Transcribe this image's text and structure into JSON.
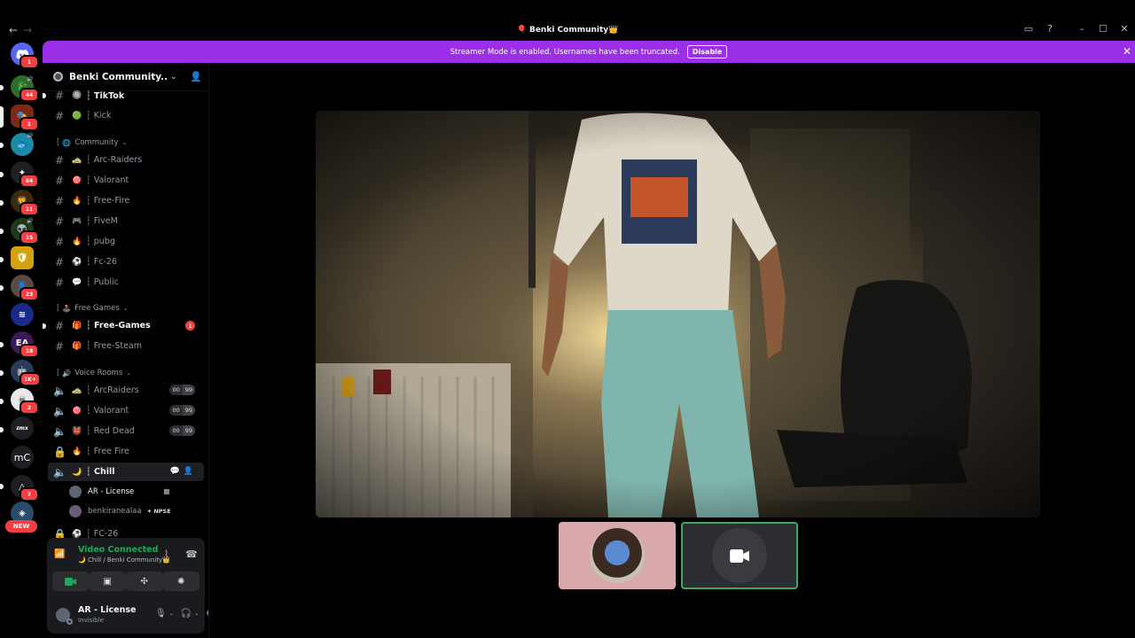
{
  "window": {
    "title": "Benki Community",
    "title_prefix_emoji": "🎈",
    "title_suffix_emoji": "👑",
    "back_icon": "arrow-left-icon",
    "forward_icon": "arrow-right-icon"
  },
  "rail": {
    "home_badge": "1",
    "badges": [
      "44",
      "1",
      "64",
      "11",
      "15",
      "23",
      "18",
      "1K+",
      "2",
      "7"
    ],
    "text_items": [
      "EA",
      "mC"
    ],
    "new_label": "NEW"
  },
  "banner": {
    "message": "Streamer Mode is enabled. Usernames have been truncated.",
    "button_label": "Disable",
    "color": "#9b2fe8"
  },
  "server": {
    "name": "Benki Community...",
    "invite_icon": "add-user-icon"
  },
  "channels": {
    "top": [
      {
        "emoji": "🔘",
        "label": "┆ TikTok",
        "unread": true
      },
      {
        "emoji": "🟢",
        "label": "┆ Kick",
        "unread": false
      }
    ],
    "community_category": {
      "emoji": "🌐",
      "label": "Community"
    },
    "community": [
      {
        "emoji": "🚕",
        "label": "┆ Arc-Raiders"
      },
      {
        "emoji": "🎯",
        "label": "┆ Valorant"
      },
      {
        "emoji": "🔥",
        "label": "┆ Free-Fire"
      },
      {
        "emoji": "🎮",
        "label": "┆ FiveM"
      },
      {
        "emoji": "🔥",
        "label": "┆ pubg"
      },
      {
        "emoji": "⚽",
        "label": "┆ Fc-26"
      },
      {
        "emoji": "💬",
        "label": "┆ Public"
      }
    ],
    "free_category": {
      "emoji": "🕹️",
      "label": "Free Games"
    },
    "free": [
      {
        "emoji": "🎁",
        "label": "┆ Free-Games",
        "mentions": "1"
      },
      {
        "emoji": "🎁",
        "label": "┆ Free-Steam"
      }
    ],
    "voice_category": {
      "emoji": "🔊",
      "label": "Voice Rooms"
    },
    "voice": [
      {
        "emoji": "🚕",
        "label": "┆ ArcRaiders",
        "count": "00",
        "limit": "99"
      },
      {
        "emoji": "🎯",
        "label": "┆ Valorant",
        "count": "00",
        "limit": "99"
      },
      {
        "emoji": "👹",
        "label": "┆ Red Dead",
        "count": "00",
        "limit": "99"
      },
      {
        "emoji": "🔥",
        "label": "┆ Free Fire"
      },
      {
        "emoji": "🌙",
        "label": "┆ Chill"
      },
      {
        "emoji": "⚽",
        "label": "┆ FC-26"
      }
    ],
    "chill_users": [
      {
        "name": "AR - License",
        "camera": true
      },
      {
        "name": "benkiranealaa",
        "tag": "NPSE"
      }
    ]
  },
  "voice_panel": {
    "status": "Video Connected",
    "location": "Chill / Benki Community",
    "location_emoji": "🌙",
    "buttons": [
      "camera-icon",
      "screen-share-icon",
      "activities-icon",
      "soundboard-icon"
    ]
  },
  "user": {
    "name": "AR - License",
    "status": "Invisible"
  },
  "stage": {
    "tiles": [
      "avatar-tile",
      "camera-off-tile"
    ]
  }
}
